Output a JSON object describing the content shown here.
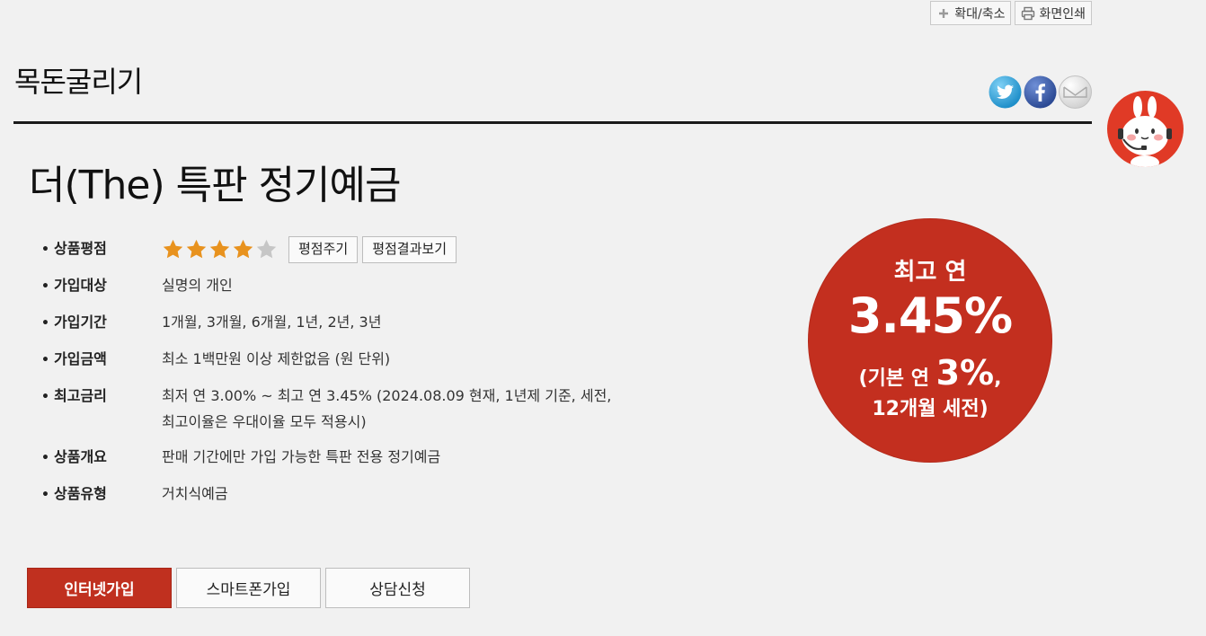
{
  "toolbar": {
    "zoom_label": "확대/축소",
    "print_label": "화면인쇄"
  },
  "category_title": "목돈굴리기",
  "share": {
    "icons": [
      "twitter-icon",
      "facebook-icon",
      "mail-icon"
    ]
  },
  "product": {
    "title": "더(The) 특판 정기예금",
    "rating": {
      "label": "상품평점",
      "stars_filled": 4,
      "stars_total": 5,
      "rate_button": "평점주기",
      "results_button": "평점결과보기"
    },
    "details": [
      {
        "label": "가입대상",
        "value": "실명의 개인"
      },
      {
        "label": "가입기간",
        "value": "1개월, 3개월, 6개월, 1년, 2년, 3년"
      },
      {
        "label": "가입금액",
        "value": "최소 1백만원 이상 제한없음 (원 단위)"
      },
      {
        "label": "최고금리",
        "value": "최저 연 3.00% ~ 최고 연 3.45% (2024.08.09 현재, 1년제 기준, 세전,",
        "value2": "최고이율은 우대이율 모두 적용시)"
      },
      {
        "label": "상품개요",
        "value": "판매 기간에만 가입 가능한 특판 전용 정기예금"
      },
      {
        "label": "상품유형",
        "value": "거치식예금"
      }
    ]
  },
  "rate_badge": {
    "heading": "최고 연",
    "rate": "3.45%",
    "base_prefix": "(기본 연 ",
    "base_rate": "3%",
    "base_suffix": ",",
    "term_line": "12개월 세전)"
  },
  "actions": {
    "internet": "인터넷가입",
    "smartphone": "스마트폰가입",
    "consult": "상담신청"
  },
  "colors": {
    "brand_red": "#c0301f",
    "star_filled": "#e8921e",
    "star_empty": "#c6c6c6"
  }
}
